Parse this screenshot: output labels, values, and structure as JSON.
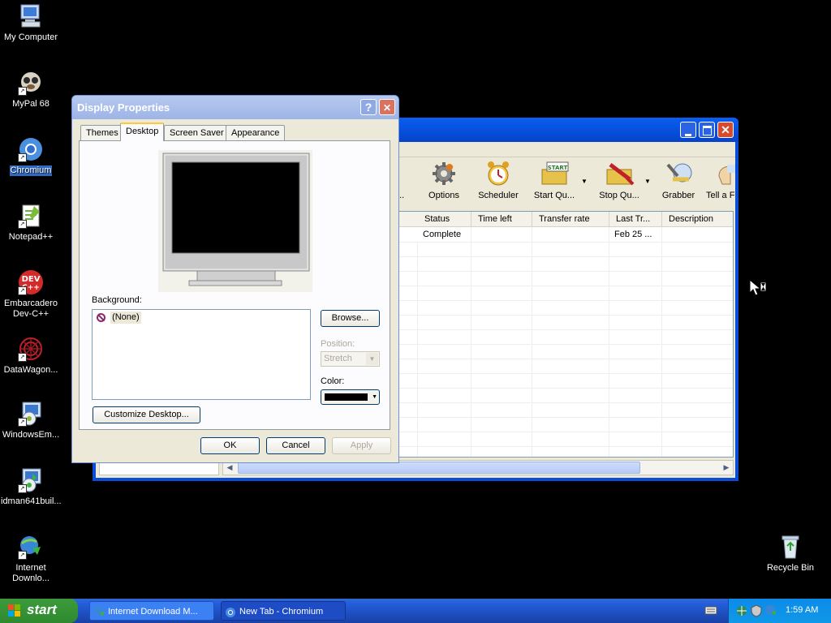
{
  "desktop": {
    "icons": [
      {
        "label": "My Computer"
      },
      {
        "label": "MyPal 68"
      },
      {
        "label": "Chromium"
      },
      {
        "label": "Notepad++"
      },
      {
        "label": "Embarcadero Dev-C++"
      },
      {
        "label": "DataWagon..."
      },
      {
        "label": "WindowsEm..."
      },
      {
        "label": "idman641buil..."
      },
      {
        "label": "Internet Downlo..."
      },
      {
        "label": "Recycle Bin"
      }
    ]
  },
  "idm": {
    "toolbar": [
      {
        "label": "...o..."
      },
      {
        "label": "Options"
      },
      {
        "label": "Scheduler"
      },
      {
        "label": "Start Qu..."
      },
      {
        "label": "Stop Qu..."
      },
      {
        "label": "Grabber"
      },
      {
        "label": "Tell a Fr"
      }
    ],
    "columns": [
      "Status",
      "Time left",
      "Transfer rate",
      "Last Tr...",
      "Description"
    ],
    "rows": [
      {
        "status": "Complete",
        "time_left": "",
        "transfer_rate": "",
        "last_try": "Feb 25 ...",
        "description": ""
      }
    ]
  },
  "display_properties": {
    "title": "Display Properties",
    "help_glyph": "?",
    "close_glyph": "✕",
    "tabs": [
      "Themes",
      "Desktop",
      "Screen Saver",
      "Appearance"
    ],
    "background_label": "Background:",
    "background_items": [
      "(None)"
    ],
    "browse_label": "Browse...",
    "position_label": "Position:",
    "position_value": "Stretch",
    "color_label": "Color:",
    "customize_label": "Customize Desktop...",
    "ok_label": "OK",
    "cancel_label": "Cancel",
    "apply_label": "Apply",
    "color_value": "#000000"
  },
  "taskbar": {
    "start_label": "start",
    "tasks": [
      {
        "label": "Internet Download M..."
      },
      {
        "label": "New Tab - Chromium"
      }
    ],
    "clock": "1:59 AM"
  }
}
